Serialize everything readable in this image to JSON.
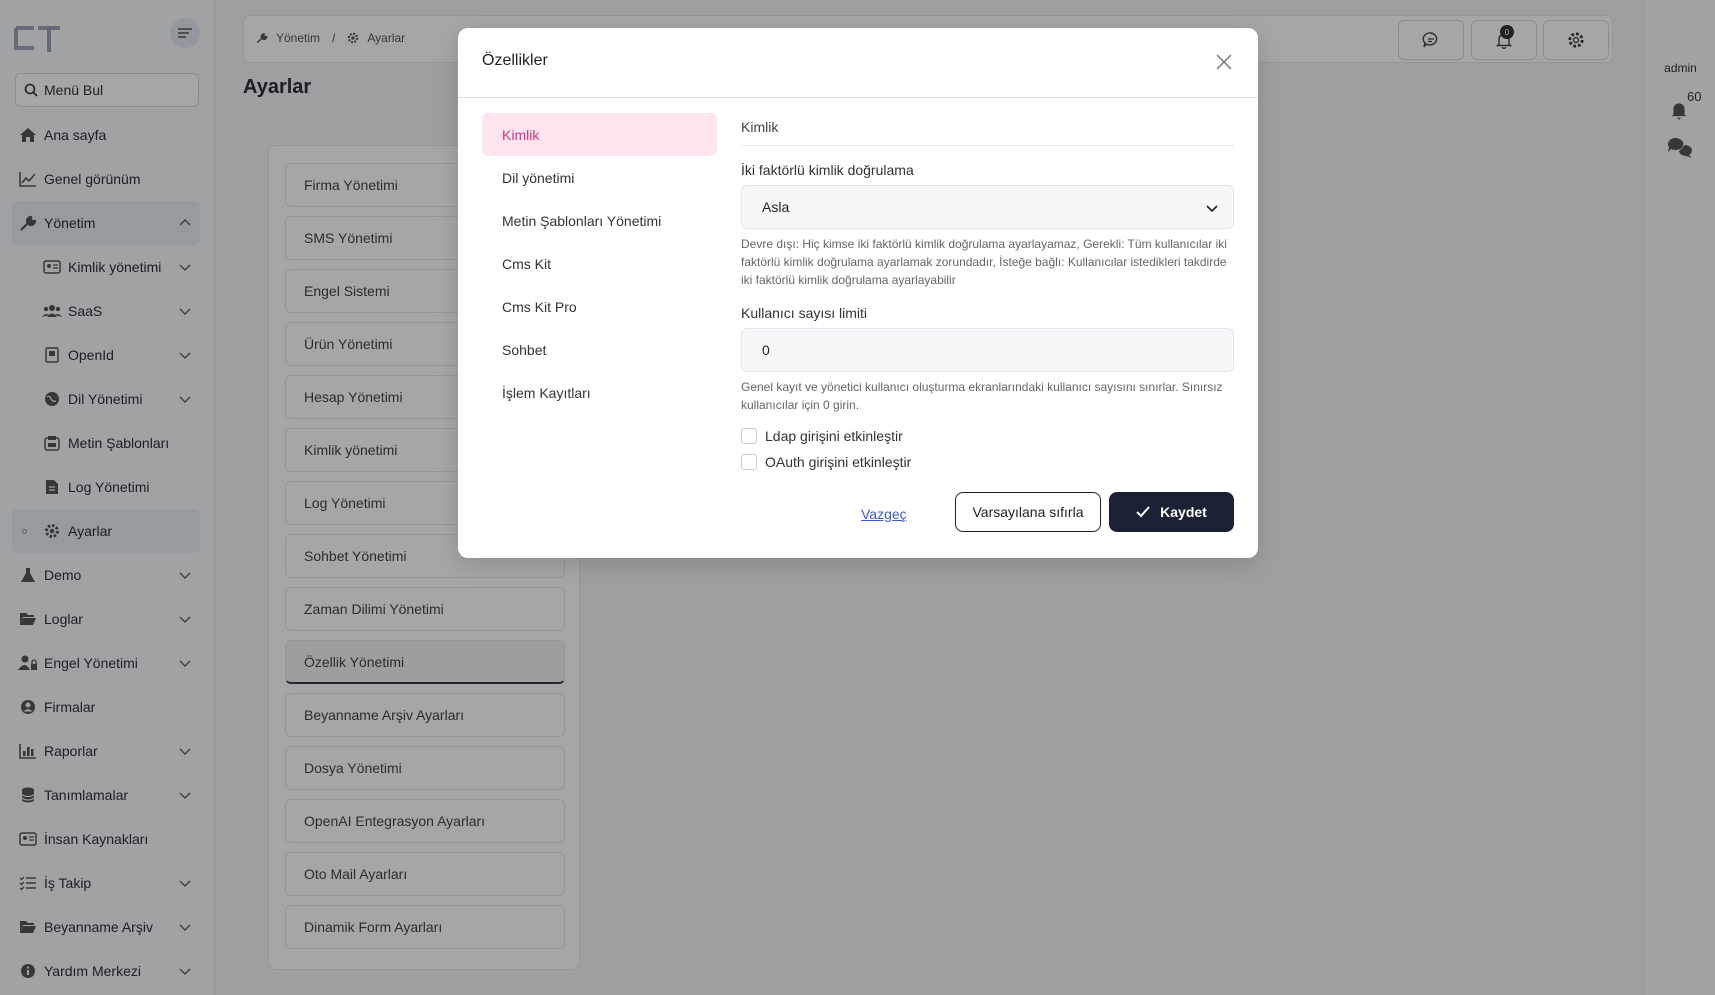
{
  "sidebar": {
    "search_label": "Menü Bul",
    "items": [
      {
        "label": "Ana sayfa"
      },
      {
        "label": "Genel görünüm"
      },
      {
        "label": "Yönetim"
      },
      {
        "label": "Kimlik yönetimi"
      },
      {
        "label": "SaaS"
      },
      {
        "label": "OpenId"
      },
      {
        "label": "Dil Yönetimi"
      },
      {
        "label": "Metin Şablonları"
      },
      {
        "label": "Log Yönetimi"
      },
      {
        "label": "Ayarlar"
      },
      {
        "label": "Demo"
      },
      {
        "label": "Loglar"
      },
      {
        "label": "Engel Yönetimi"
      },
      {
        "label": "Firmalar"
      },
      {
        "label": "Raporlar"
      },
      {
        "label": "Tanımlamalar"
      },
      {
        "label": "İnsan Kaynakları"
      },
      {
        "label": "İş Takip"
      },
      {
        "label": "Beyanname Arşiv"
      },
      {
        "label": "Yardım Merkezi"
      }
    ]
  },
  "topbar": {
    "breadcrumb_1": "Yönetim",
    "breadcrumb_sep": "/",
    "breadcrumb_2": "Ayarlar",
    "notification_badge": "0"
  },
  "page": {
    "title": "Ayarlar"
  },
  "settings_list": [
    {
      "label": "Firma Yönetimi"
    },
    {
      "label": "SMS Yönetimi"
    },
    {
      "label": "Engel Sistemi"
    },
    {
      "label": "Ürün Yönetimi"
    },
    {
      "label": "Hesap Yönetimi"
    },
    {
      "label": "Kimlik yönetimi"
    },
    {
      "label": "Log Yönetimi"
    },
    {
      "label": "Sohbet Yönetimi"
    },
    {
      "label": "Zaman Dilimi Yönetimi"
    },
    {
      "label": "Özellik Yönetimi"
    },
    {
      "label": "Beyanname Arşiv Ayarları"
    },
    {
      "label": "Dosya Yönetimi"
    },
    {
      "label": "OpenAI Entegrasyon Ayarları"
    },
    {
      "label": "Oto Mail Ayarları"
    },
    {
      "label": "Dinamik Form Ayarları"
    }
  ],
  "rail": {
    "user": "admin",
    "count": "60"
  },
  "modal": {
    "title": "Özellikler",
    "tabs": [
      {
        "label": "Kimlik"
      },
      {
        "label": "Dil yönetimi"
      },
      {
        "label": "Metin Şablonları Yönetimi"
      },
      {
        "label": "Cms Kit"
      },
      {
        "label": "Cms Kit Pro"
      },
      {
        "label": "Sohbet"
      },
      {
        "label": "İşlem Kayıtları"
      }
    ],
    "section_title": "Kimlik",
    "two_factor_label": "İki faktörlü kimlik doğrulama",
    "two_factor_value": "Asla",
    "two_factor_help": "Devre dışı: Hiç kimse iki faktörlü kimlik doğrulama ayarlayamaz, Gerekli: Tüm kullanıcılar iki faktörlü kimlik doğrulama ayarlamak zorundadır, İsteğe bağlı: Kullanıcılar istedikleri takdirde iki faktörlü kimlik doğrulama ayarlayabilir",
    "user_limit_label": "Kullanıcı sayısı limiti",
    "user_limit_value": "0",
    "user_limit_help": "Genel kayıt ve yönetici kullanıcı oluşturma ekranlarındaki kullanıcı sayısını sınırlar. Sınırsız kullanıcılar için 0 girin.",
    "ldap_label": "Ldap girişini etkinleştir",
    "oauth_label": "OAuth girişini etkinleştir",
    "cancel_label": "Vazgeç",
    "reset_label": "Varsayılana sıfırla",
    "save_label": "Kaydet"
  },
  "colors": {
    "accent_pink": "#d63384",
    "primary_dark": "#1a2133"
  }
}
